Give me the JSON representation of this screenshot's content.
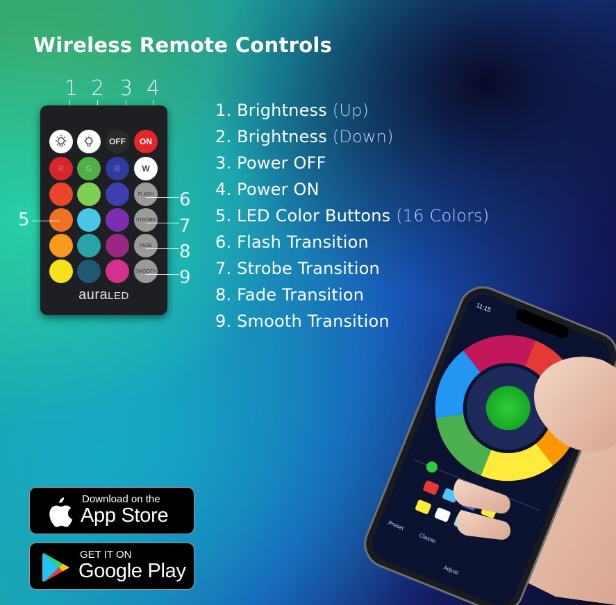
{
  "header": {
    "title": "Wireless Remote Controls"
  },
  "remote": {
    "callouts_top": [
      "1",
      "2",
      "3",
      "4"
    ],
    "callouts_side": [
      "5",
      "6",
      "7",
      "8",
      "9"
    ],
    "buttons": {
      "off": "OFF",
      "on": "ON",
      "r": "R",
      "g": "G",
      "b": "B",
      "w": "W",
      "flash": "FLASH",
      "strobe": "STROBE",
      "fade": "FADE",
      "smooth": "SMOOTH"
    },
    "brand_main": "aura",
    "brand_sub": "LED",
    "colors": {
      "row3": [
        "#e8462a",
        "#7fcf54",
        "#3d3fb0"
      ],
      "row4": [
        "#f07222",
        "#48c6e3",
        "#7a2fae"
      ],
      "row5": [
        "#f79a1e",
        "#2aa3a8",
        "#9a2880"
      ],
      "row6": [
        "#f6e11d",
        "#1f5870",
        "#d3318d"
      ]
    }
  },
  "features": [
    {
      "label": "1. Brightness",
      "note": " (Up)"
    },
    {
      "label": "2. Brightness",
      "note": " (Down)"
    },
    {
      "label": "3. Power OFF",
      "note": ""
    },
    {
      "label": "4. Power ON",
      "note": ""
    },
    {
      "label": "5. LED Color Buttons",
      "note": " (16 Colors)"
    },
    {
      "label": "6. Flash Transition",
      "note": ""
    },
    {
      "label": "7. Strobe Transition",
      "note": ""
    },
    {
      "label": "8. Fade Transition",
      "note": ""
    },
    {
      "label": "9. Smooth Transition",
      "note": ""
    }
  ],
  "stores": {
    "apple": {
      "small": "Download on the",
      "big": "App Store",
      "icon": "apple-logo-icon"
    },
    "google": {
      "small": "GET IT ON",
      "big": "Google Play",
      "icon": "google-play-logo-icon"
    }
  },
  "phone": {
    "time": "11:15",
    "menu_labels": [
      "Preset",
      "Classic",
      "Adjust"
    ]
  }
}
